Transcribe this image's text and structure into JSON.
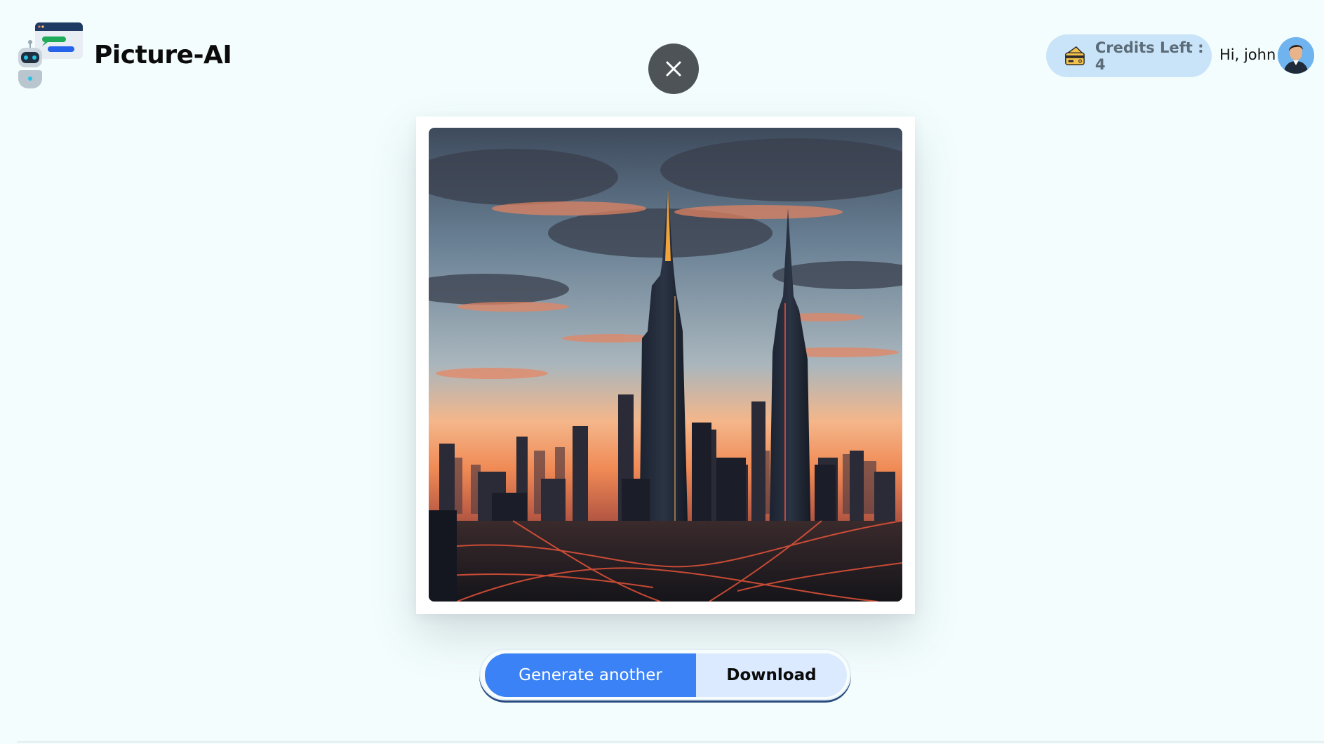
{
  "brand": {
    "name": "Picture-AI"
  },
  "header": {
    "credits_label": "Credits Left : 4",
    "greeting": "Hi, john"
  },
  "actions": {
    "generate_label": "Generate another",
    "download_label": "Download"
  },
  "icons": {
    "close": "close-icon",
    "credits": "credit-card-icon",
    "avatar": "user-avatar",
    "logo": "robot-chat-logo-icon"
  },
  "colors": {
    "background": "#f3fdfd",
    "primary": "#3b82f6",
    "secondary": "#dbeafe",
    "credits_pill": "#c9e4f8",
    "close_button": "#4d5356"
  }
}
